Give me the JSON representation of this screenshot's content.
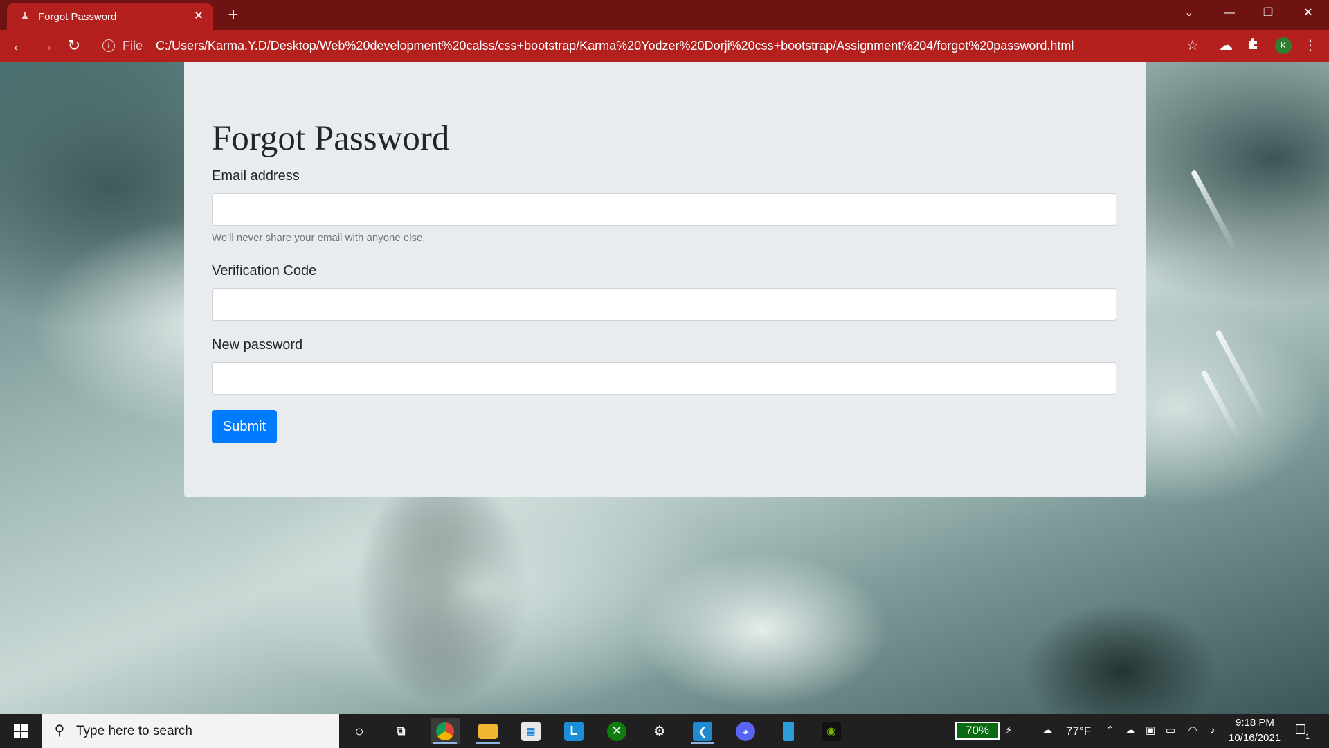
{
  "browser": {
    "tab_title": "Forgot Password",
    "tab_close": "✕",
    "new_tab": "+",
    "file_label": "File",
    "url": "C:/Users/Karma.Y.D/Desktop/Web%20development%20calss/css+bootstrap/Karma%20Yodzer%20Dorji%20css+bootstrap/Assignment%204/forgot%20password.html",
    "profile_initial": "K",
    "theme_color": "#b3201e",
    "icons": {
      "favicon": "person-icon",
      "back": "arrow-left-icon",
      "forward": "arrow-right-icon",
      "reload": "reload-icon",
      "info": "info-icon",
      "bookmark": "star-icon",
      "extension_cloud": "cloud-extension-icon",
      "extensions": "puzzle-icon",
      "menu": "kebab-menu-icon"
    }
  },
  "page": {
    "title": "Forgot Password",
    "email_label": "Email address",
    "email_value": "",
    "email_help": "We'll never share your email with anyone else.",
    "code_label": "Verification Code",
    "code_value": "",
    "password_label": "New password",
    "password_value": "",
    "submit_label": "Submit",
    "accent_color": "#007bff"
  },
  "taskbar": {
    "search_placeholder": "Type here to search",
    "apps": [
      "Cortana",
      "Task View",
      "Google Chrome",
      "File Explorer",
      "Microsoft Store",
      "Launcher L",
      "Xbox",
      "Steam",
      "Visual Studio Code",
      "Discord",
      "Phone",
      "NVIDIA GeForce"
    ],
    "battery_percent": "70%",
    "temperature": "77°F",
    "time": "9:18 PM",
    "date": "10/16/2021",
    "notification_count": "1"
  }
}
